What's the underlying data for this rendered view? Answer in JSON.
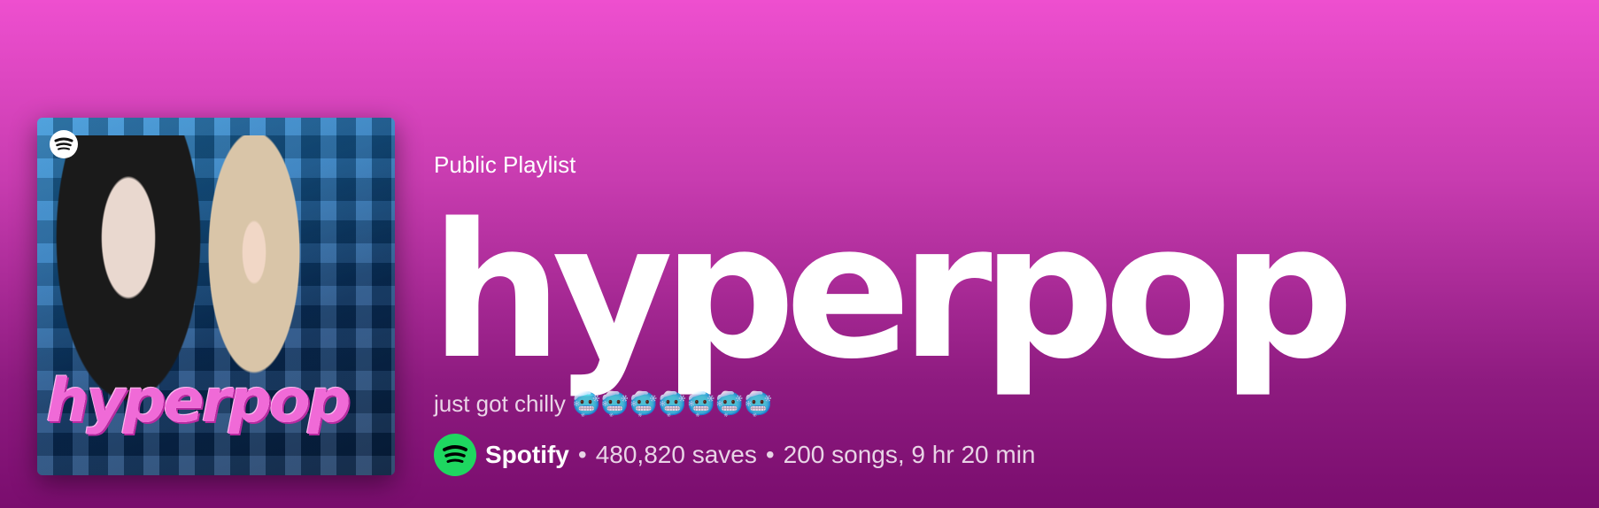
{
  "playlist": {
    "type_label": "Public Playlist",
    "title": "hyperpop",
    "description": "just got chilly 🥶🥶🥶🥶🥶🥶🥶",
    "cover_title": "hyperpop",
    "owner": "Spotify",
    "separator": "•",
    "saves": "480,820 saves",
    "stats": "200 songs, 9 hr 20 min"
  },
  "colors": {
    "gradient_top": "#ee4fcf",
    "gradient_bottom": "#7a0d6e",
    "spotify_green": "#1ed760"
  },
  "icons": {
    "cover_logo": "spotify-logo-icon",
    "owner_avatar": "spotify-avatar-icon"
  }
}
